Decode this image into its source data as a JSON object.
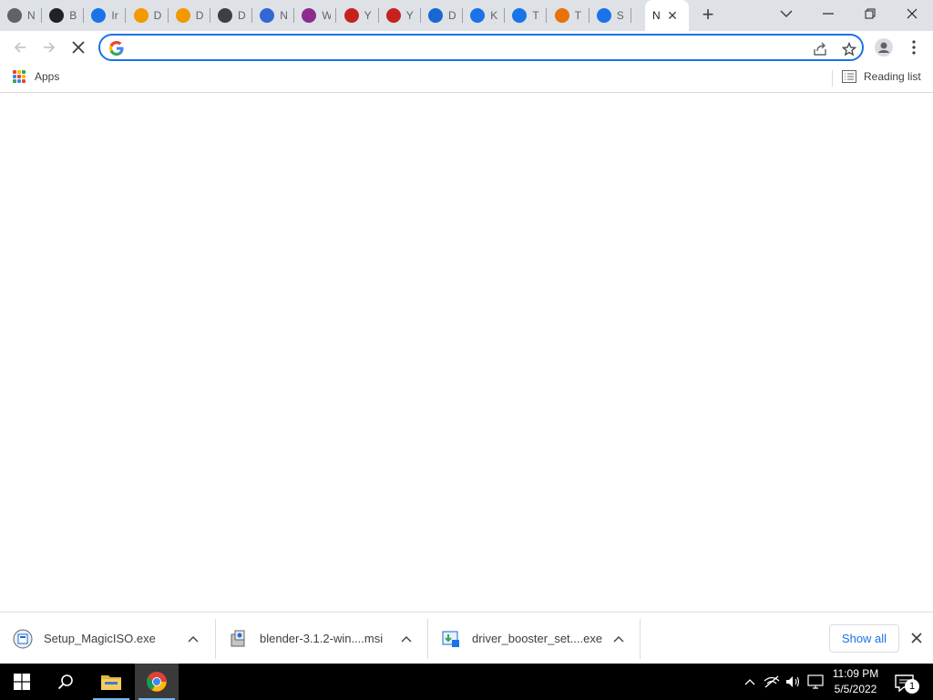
{
  "tabs": [
    {
      "letter": "N",
      "icon": "chrome-icon",
      "color": "#5f6368"
    },
    {
      "letter": "B",
      "icon": "record-icon",
      "color": "#202124"
    },
    {
      "letter": "Ir",
      "icon": "installer-icon",
      "color": "#1a73e8"
    },
    {
      "letter": "D",
      "icon": "download-site-icon",
      "color": "#f29900"
    },
    {
      "letter": "D",
      "icon": "download-site-icon",
      "color": "#f29900"
    },
    {
      "letter": "D",
      "icon": "disc-icon",
      "color": "#3c4043"
    },
    {
      "letter": "N",
      "icon": "sail-icon",
      "color": "#3367d6"
    },
    {
      "letter": "W",
      "icon": "winrar-icon",
      "color": "#8e2c8e"
    },
    {
      "letter": "Y",
      "icon": "media-player-icon",
      "color": "#c5221f"
    },
    {
      "letter": "Y",
      "icon": "media-player-icon",
      "color": "#c5221f"
    },
    {
      "letter": "D",
      "icon": "arrow-down-icon",
      "color": "#1967d2"
    },
    {
      "letter": "K",
      "icon": "blue-square-icon",
      "color": "#1a73e8"
    },
    {
      "letter": "T",
      "icon": "blue-square-icon",
      "color": "#1a73e8"
    },
    {
      "letter": "T",
      "icon": "blender-icon",
      "color": "#e8710a"
    },
    {
      "letter": "S",
      "icon": "loading-icon",
      "color": "#1a73e8"
    }
  ],
  "active_tab": {
    "title": "N"
  },
  "omnibox": {
    "value": "",
    "placeholder": ""
  },
  "bookmarks": {
    "apps_label": "Apps",
    "reading_list_label": "Reading list"
  },
  "downloads": [
    {
      "name": "Setup_MagicISO.exe",
      "icon": "magiciso-icon"
    },
    {
      "name": "blender-3.1.2-win....msi",
      "icon": "msi-package-icon"
    },
    {
      "name": "driver_booster_set....exe",
      "icon": "driver-booster-icon"
    }
  ],
  "shelf": {
    "show_all_label": "Show all"
  },
  "taskbar": {
    "time": "11:09 PM",
    "date": "5/5/2022",
    "notification_count": "1"
  }
}
